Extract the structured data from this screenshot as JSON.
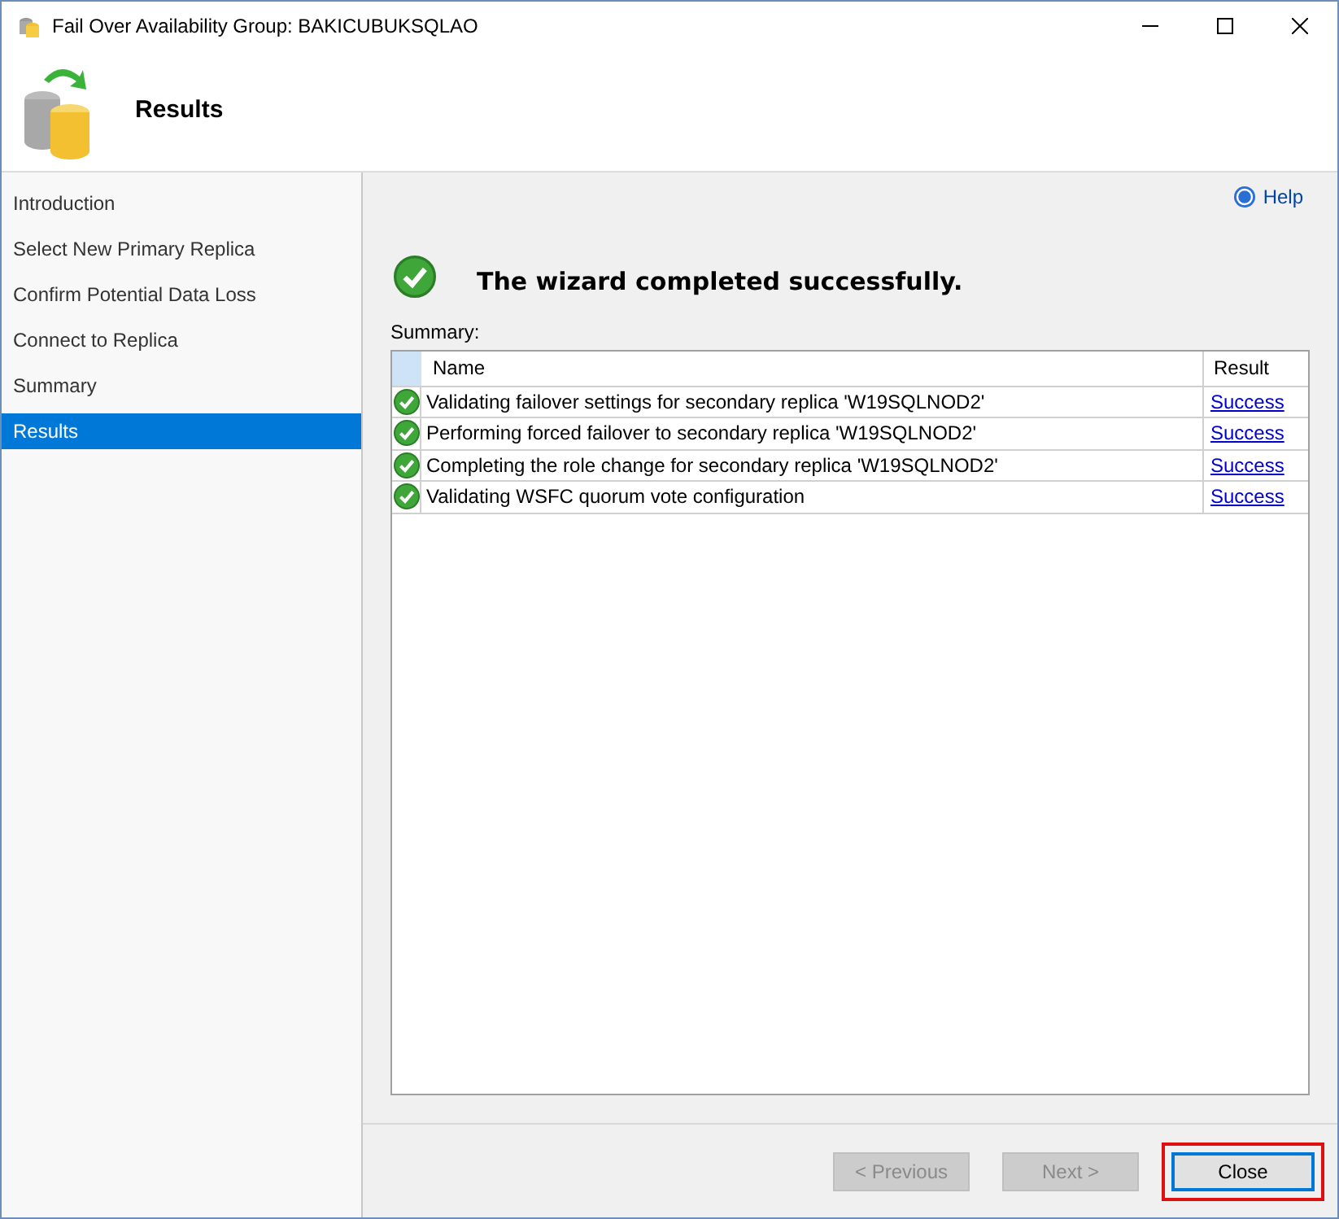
{
  "window": {
    "title": "Fail Over Availability Group: BAKICUBUKSQLAO"
  },
  "header": {
    "title": "Results"
  },
  "sidebar": {
    "items": [
      {
        "label": "Introduction",
        "selected": false
      },
      {
        "label": "Select New Primary Replica",
        "selected": false
      },
      {
        "label": "Confirm Potential Data Loss",
        "selected": false
      },
      {
        "label": "Connect to Replica",
        "selected": false
      },
      {
        "label": "Summary",
        "selected": false
      },
      {
        "label": "Results",
        "selected": true
      }
    ]
  },
  "help": "Help",
  "status_message": "The wizard completed successfully.",
  "summary_label": "Summary:",
  "table": {
    "columns": [
      "Name",
      "Result"
    ],
    "rows": [
      {
        "name": "Validating failover settings for secondary replica 'W19SQLNOD2'",
        "result": "Success"
      },
      {
        "name": "Performing forced failover to secondary replica 'W19SQLNOD2'",
        "result": "Success"
      },
      {
        "name": "Completing the role change for secondary replica 'W19SQLNOD2'",
        "result": "Success"
      },
      {
        "name": "Validating WSFC quorum vote configuration",
        "result": "Success"
      }
    ]
  },
  "buttons": [
    {
      "label": "< Previous",
      "disabled": true,
      "highlighted": false
    },
    {
      "label": "Next >",
      "disabled": true,
      "highlighted": false
    },
    {
      "label": "Close",
      "disabled": false,
      "highlighted": true
    }
  ]
}
